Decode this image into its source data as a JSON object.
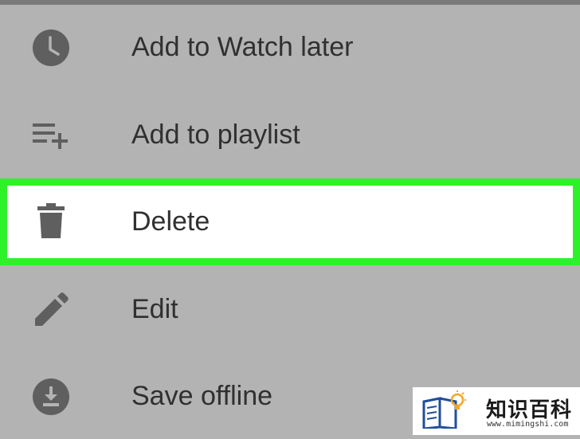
{
  "menu": {
    "items": [
      {
        "label": "Add to Watch later",
        "icon": "clock-icon"
      },
      {
        "label": "Add to playlist",
        "icon": "playlist-add-icon"
      },
      {
        "label": "Delete",
        "icon": "trash-icon",
        "highlighted": true
      },
      {
        "label": "Edit",
        "icon": "pencil-icon"
      },
      {
        "label": "Save offline",
        "icon": "download-icon"
      }
    ]
  },
  "watermark": {
    "title": "知识百科",
    "url": "www.mimingshi.com"
  },
  "colors": {
    "background": "#b3b3b3",
    "highlight_border": "#2ff12a",
    "highlight_fill": "#ffffff",
    "icon": "#606060",
    "text": "#303030",
    "logo_blue": "#1f4e9c",
    "logo_orange": "#f5a623"
  }
}
